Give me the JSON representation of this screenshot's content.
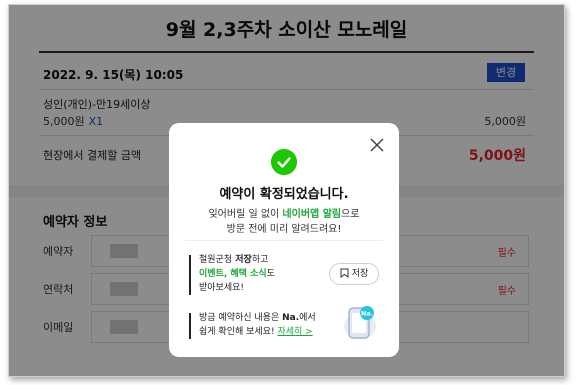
{
  "page": {
    "title": "9월 2,3주차 소이산 모노레일",
    "date": "2022. 9. 15(목) 10:05",
    "change_button": "변경",
    "ticket": {
      "name": "성인(개인)-만19세이상",
      "price": "5,000원",
      "qty": "X1",
      "subtotal": "5,000원"
    },
    "pay_label": "현장에서 결제할 금액",
    "pay_amount": "5,000원",
    "booker_section": "예약자 정보",
    "fields": [
      {
        "label": "예약자",
        "required": "필수"
      },
      {
        "label": "연락처",
        "required": "필수"
      },
      {
        "label": "이메일",
        "required": ""
      }
    ]
  },
  "modal": {
    "title": "예약이 확정되었습니다.",
    "sub_line1_pre": "잊어버릴 일 없이 ",
    "sub_line1_highlight": "네이버앱 알림",
    "sub_line1_post": "으로",
    "sub_line2": "방문 전에 미리 알려드려요!",
    "promo1_line1_a": "철원군청",
    "promo1_line1_b": " 저장",
    "promo1_line1_c": "하고",
    "promo1_line2_highlight": "이벤트, 혜택 소식",
    "promo1_line2_post": "도",
    "promo1_line3": "받아보세요!",
    "save_button": "저장",
    "promo2_line1_pre": "방금 예약하신 내용은 ",
    "promo2_line1_bold": "Na.",
    "promo2_line1_post": "에서",
    "promo2_line2": "쉽게 확인해 보세요!",
    "promo2_link": "자세히 >",
    "phone_badge": "Na."
  },
  "colors": {
    "accent_green": "#1ec800",
    "link_blue": "#1f4fd1",
    "price_red": "#e4242b"
  }
}
